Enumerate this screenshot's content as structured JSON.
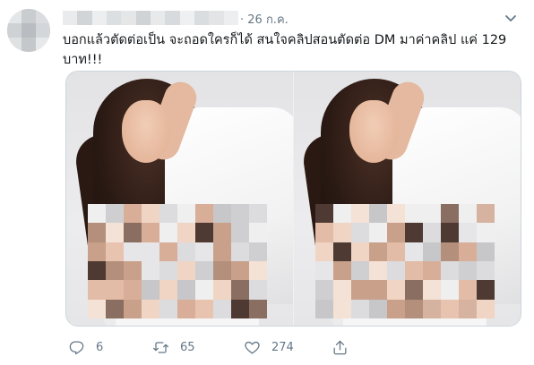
{
  "tweet": {
    "time": "· 26 ก.ค.",
    "text": "บอกแล้วตัดต่อเป็น จะถอดใครก็ได้ สนใจคลิปสอนตัดต่อ DM มาค่าคลิป แค่ 129 บาท!!!",
    "reply_count": "6",
    "retweet_count": "65",
    "like_count": "274"
  },
  "icons": {
    "reply": "reply-icon",
    "retweet": "retweet-icon",
    "like": "heart-icon",
    "share": "share-icon",
    "menu": "chevron-down-icon"
  },
  "colors": {
    "text": "#14171a",
    "secondary": "#657786",
    "border": "#ccd6dd"
  }
}
